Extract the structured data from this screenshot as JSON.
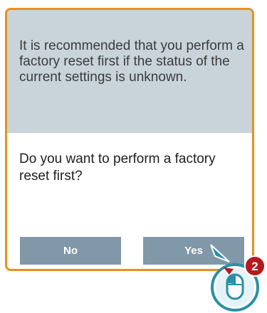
{
  "dialog": {
    "info_text": "It is recommended that you perform a factory reset first if the status of the current settings is unknown.",
    "question_text": "Do you want to perform a factory reset first?",
    "buttons": {
      "no_label": "No",
      "yes_label": "Yes"
    }
  },
  "annotation": {
    "step_number": "2",
    "icon": "mouse-click-icon"
  },
  "colors": {
    "dialog_border": "#e8901f",
    "info_background": "#c9d3da",
    "button_background": "#8198a9",
    "step_badge": "#b5191e",
    "mouse_accent": "#2a8fa6"
  }
}
